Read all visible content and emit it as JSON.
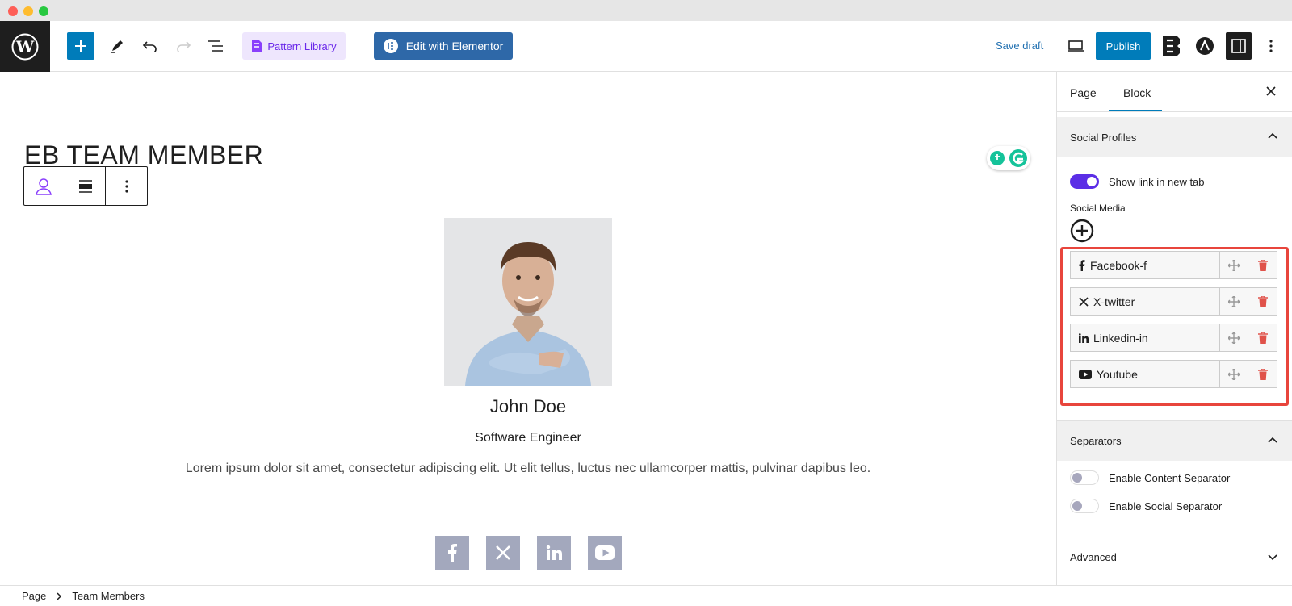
{
  "toolbar": {
    "pattern_library": "Pattern Library",
    "edit_elementor": "Edit with Elementor",
    "save_draft": "Save draft",
    "publish": "Publish"
  },
  "canvas": {
    "title": "EB TEAM MEMBER",
    "member": {
      "name": "John Doe",
      "role": "Software Engineer",
      "description": "Lorem ipsum dolor sit amet, consectetur adipiscing elit. Ut elit tellus, luctus nec ullamcorper mattis, pulvinar dapibus leo."
    },
    "social_icons": [
      "facebook-icon",
      "x-twitter-icon",
      "linkedin-icon",
      "youtube-icon"
    ]
  },
  "sidebar": {
    "tabs": [
      "Page",
      "Block"
    ],
    "active_tab": "Block",
    "social_profiles": {
      "heading": "Social Profiles",
      "show_link_label": "Show link in new tab",
      "social_media_label": "Social Media",
      "items": [
        {
          "icon": "facebook-icon",
          "label": "Facebook-f"
        },
        {
          "icon": "x-twitter-icon",
          "label": "X-twitter"
        },
        {
          "icon": "linkedin-icon",
          "label": "Linkedin-in"
        },
        {
          "icon": "youtube-icon",
          "label": "Youtube"
        }
      ]
    },
    "separators": {
      "heading": "Separators",
      "content_label": "Enable Content Separator",
      "social_label": "Enable Social Separator"
    },
    "advanced": {
      "heading": "Advanced"
    }
  },
  "breadcrumb": {
    "items": [
      "Page",
      "Team Members"
    ]
  },
  "colors": {
    "accent": "#007cba",
    "toggle_on": "#5b2ee6",
    "social_bg": "#a3a8bd",
    "highlight": "#e8453c",
    "delete": "#e0524a"
  }
}
